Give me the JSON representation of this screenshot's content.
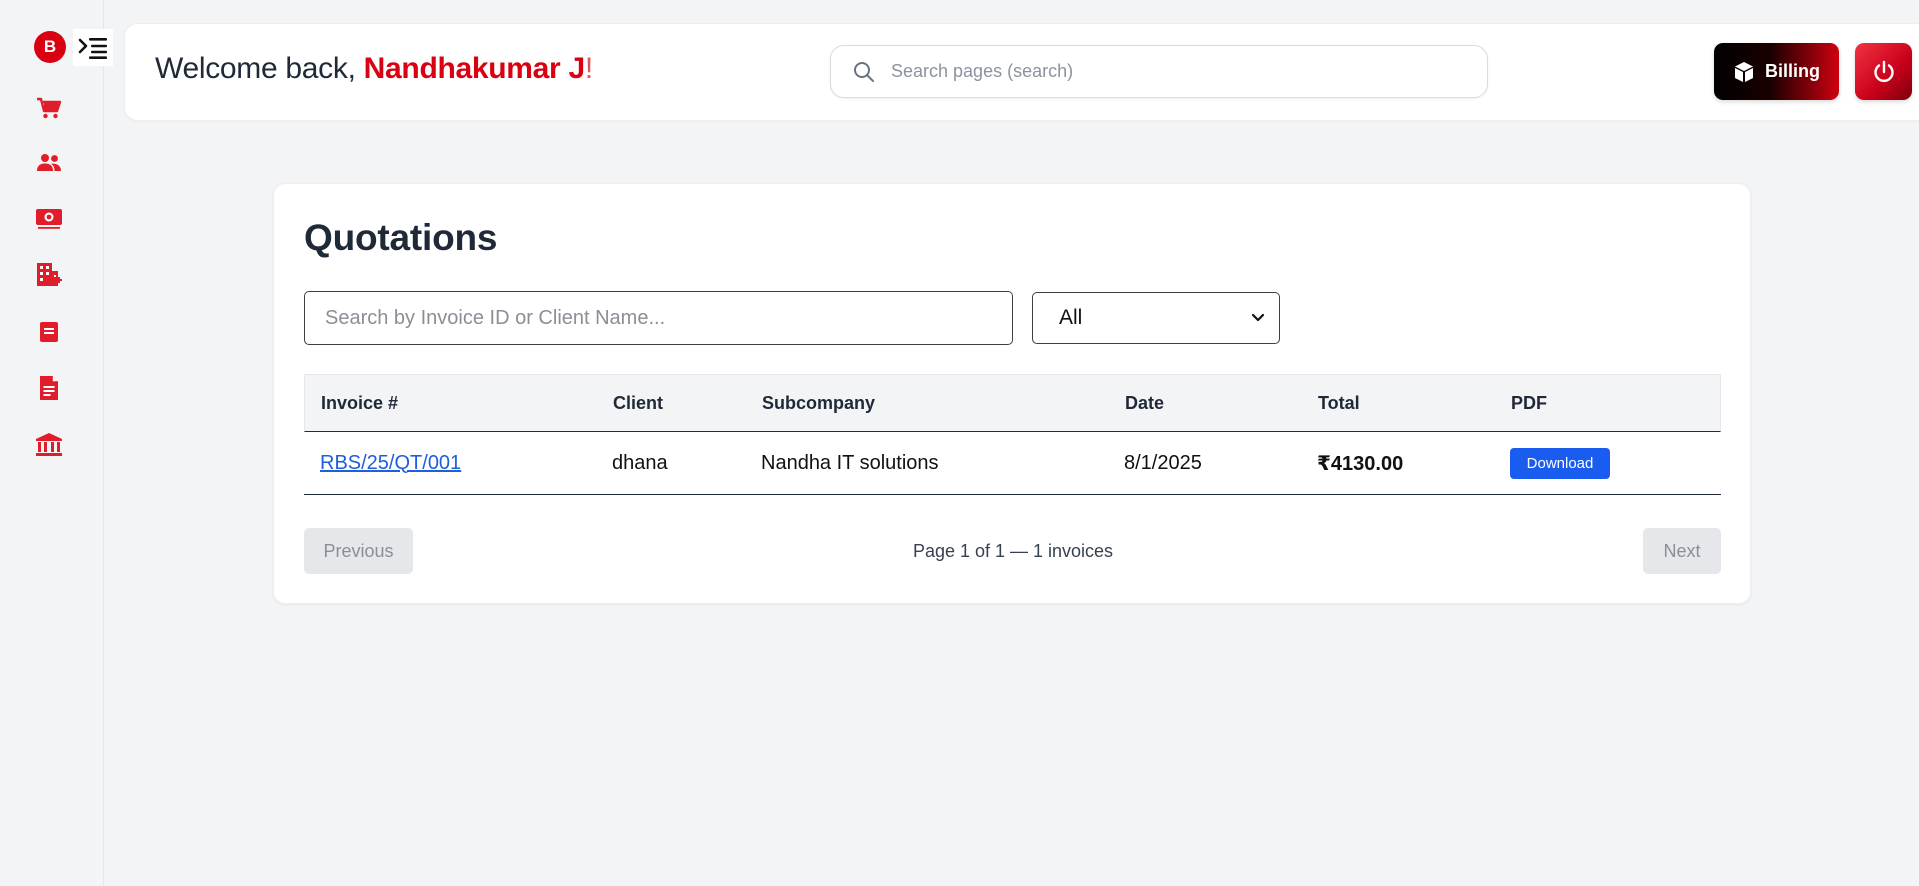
{
  "sidebar": {
    "brand_initial": "B",
    "items": [
      {
        "name": "cart-icon"
      },
      {
        "name": "users-icon"
      },
      {
        "name": "cash-icon"
      },
      {
        "name": "building-add-icon"
      },
      {
        "name": "document-icon"
      },
      {
        "name": "file-text-icon"
      },
      {
        "name": "bank-icon"
      }
    ],
    "accent_color": "#e11d2b"
  },
  "header": {
    "welcome_prefix": "Welcome back, ",
    "user_name": "Nandhakumar J",
    "welcome_suffix": "!",
    "search_placeholder": "Search pages (search)",
    "billing_label": "Billing"
  },
  "main": {
    "title": "Quotations",
    "search_placeholder": "Search by Invoice ID or Client Name...",
    "filter_selected": "All",
    "table": {
      "headers": [
        "Invoice #",
        "Client",
        "Subcompany",
        "Date",
        "Total",
        "PDF"
      ],
      "rows": [
        {
          "invoice": "RBS/25/QT/001",
          "client": "dhana",
          "subcompany": "Nandha IT solutions",
          "date": "8/1/2025",
          "total": "₹4130.00",
          "pdf_label": "Download"
        }
      ]
    },
    "pagination": {
      "previous_label": "Previous",
      "info": "Page 1 of 1 — 1 invoices",
      "next_label": "Next"
    }
  },
  "colors": {
    "brand_red": "#d90012",
    "link_blue": "#1d5fdc",
    "download_blue": "#1a5cf0"
  }
}
